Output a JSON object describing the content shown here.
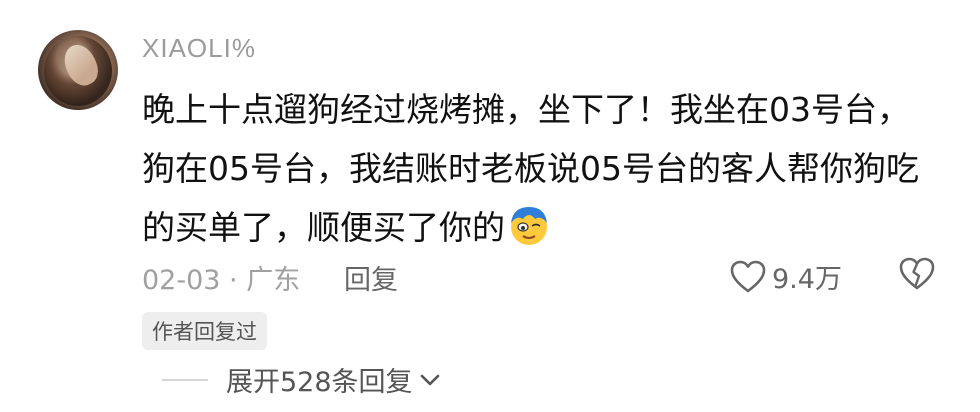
{
  "comment": {
    "username": "XIAOLI%",
    "text": "晚上十点遛狗经过烧烤摊，坐下了！我坐在03号台，狗在05号台，我结账时老板说05号台的客人帮你狗吃的买单了，顺便买了你的",
    "emoji_icon": "exhausted-face-emoji",
    "date_location": "02-03 · 广东",
    "reply_label": "回复",
    "like_count": "9.4万",
    "author_badge": "作者回复过",
    "expand_label": "展开528条回复"
  },
  "colors": {
    "text": "#111111",
    "muted": "#9b9b9b",
    "badge_bg": "#eeeeee",
    "emoji_blue": "#2f7fd8",
    "emoji_yellow": "#ffc93c"
  }
}
